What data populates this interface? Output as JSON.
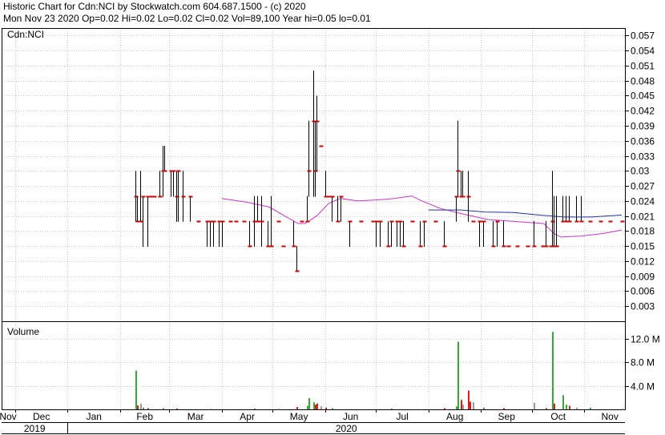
{
  "header": {
    "line1": "Historic Chart for Cdn:NCI by Stockwatch.com 604.687.1500 - (c) 2020",
    "line2": "Mon Nov 23 2020  Op=0.02  Hi=0.02  Lo=0.02  Cl=0.02  Vol=89,100  Year hi=0.05  lo=0.01"
  },
  "chart_data": [
    {
      "type": "ohlc",
      "panel_label": "Cdn:NCI",
      "y_ticks": [
        "0.057",
        "0.054",
        "0.051",
        "0.048",
        "0.045",
        "0.042",
        "0.039",
        "0.036",
        "0.033",
        "0.03",
        "0.027",
        "0.024",
        "0.021",
        "0.018",
        "0.015",
        "0.012",
        "0.009",
        "0.006",
        "0.003"
      ],
      "ylim": [
        0,
        0.0585
      ],
      "x_month_labels": [
        "Nov",
        "Dec",
        "Jan",
        "Feb",
        "Mar",
        "Apr",
        "May",
        "Jun",
        "Jul",
        "Aug",
        "Sep",
        "Oct",
        "Nov"
      ],
      "x_year_labels": [
        "2019",
        "2020"
      ],
      "grid": true,
      "price_color": "#000000",
      "close_tick_color": "#cc0000",
      "bars": [
        {
          "date": "2020-02-10",
          "h": 0.03,
          "l": 0.02,
          "c": 0.025
        },
        {
          "date": "2020-02-11",
          "h": 0.025,
          "l": 0.02,
          "c": 0.02
        },
        {
          "date": "2020-02-13",
          "h": 0.03,
          "l": 0.02,
          "c": 0.02
        },
        {
          "date": "2020-02-14",
          "h": 0.025,
          "l": 0.015,
          "c": 0.025
        },
        {
          "date": "2020-02-17",
          "h": 0.025,
          "l": 0.015,
          "c": 0.025
        },
        {
          "date": "2020-02-19",
          "h": 0.025,
          "l": 0.025,
          "c": 0.025
        },
        {
          "date": "2020-02-21",
          "h": 0.025,
          "l": 0.025,
          "c": 0.025
        },
        {
          "date": "2020-02-24",
          "h": 0.03,
          "l": 0.025,
          "c": 0.025
        },
        {
          "date": "2020-02-26",
          "h": 0.035,
          "l": 0.025,
          "c": 0.03
        },
        {
          "date": "2020-02-27",
          "h": 0.035,
          "l": 0.03,
          "c": 0.03
        },
        {
          "date": "2020-03-02",
          "h": 0.03,
          "l": 0.025,
          "c": 0.03
        },
        {
          "date": "2020-03-03",
          "h": 0.03,
          "l": 0.025,
          "c": 0.03
        },
        {
          "date": "2020-03-05",
          "h": 0.03,
          "l": 0.02,
          "c": 0.025
        },
        {
          "date": "2020-03-06",
          "h": 0.03,
          "l": 0.02,
          "c": 0.03
        },
        {
          "date": "2020-03-09",
          "h": 0.03,
          "l": 0.02,
          "c": 0.025
        },
        {
          "date": "2020-03-13",
          "h": 0.025,
          "l": 0.02,
          "c": 0.025
        },
        {
          "date": "2020-03-18",
          "h": 0.02,
          "l": 0.02,
          "c": 0.02
        },
        {
          "date": "2020-03-23",
          "h": 0.02,
          "l": 0.015,
          "c": 0.02
        },
        {
          "date": "2020-03-25",
          "h": 0.02,
          "l": 0.015,
          "c": 0.02
        },
        {
          "date": "2020-03-27",
          "h": 0.02,
          "l": 0.015,
          "c": 0.02
        },
        {
          "date": "2020-03-30",
          "h": 0.02,
          "l": 0.015,
          "c": 0.02
        },
        {
          "date": "2020-04-01",
          "h": 0.02,
          "l": 0.015,
          "c": 0.02
        },
        {
          "date": "2020-04-06",
          "h": 0.02,
          "l": 0.02,
          "c": 0.02
        },
        {
          "date": "2020-04-09",
          "h": 0.02,
          "l": 0.02,
          "c": 0.02
        },
        {
          "date": "2020-04-14",
          "h": 0.02,
          "l": 0.02,
          "c": 0.02
        },
        {
          "date": "2020-04-17",
          "h": 0.02,
          "l": 0.015,
          "c": 0.015
        },
        {
          "date": "2020-04-20",
          "h": 0.025,
          "l": 0.015,
          "c": 0.02
        },
        {
          "date": "2020-04-22",
          "h": 0.025,
          "l": 0.02,
          "c": 0.02
        },
        {
          "date": "2020-04-24",
          "h": 0.025,
          "l": 0.015,
          "c": 0.02
        },
        {
          "date": "2020-04-28",
          "h": 0.02,
          "l": 0.015,
          "c": 0.015
        },
        {
          "date": "2020-04-30",
          "h": 0.025,
          "l": 0.015,
          "c": 0.015
        },
        {
          "date": "2020-05-04",
          "h": 0.02,
          "l": 0.02,
          "c": 0.02
        },
        {
          "date": "2020-05-07",
          "h": 0.015,
          "l": 0.015,
          "c": 0.015
        },
        {
          "date": "2020-05-13",
          "h": 0.02,
          "l": 0.015,
          "c": 0.015
        },
        {
          "date": "2020-05-15",
          "h": 0.015,
          "l": 0.01,
          "c": 0.01
        },
        {
          "date": "2020-05-18",
          "h": 0.02,
          "l": 0.02,
          "c": 0.02
        },
        {
          "date": "2020-05-21",
          "h": 0.025,
          "l": 0.02,
          "c": 0.02
        },
        {
          "date": "2020-05-22",
          "h": 0.04,
          "l": 0.025,
          "c": 0.03
        },
        {
          "date": "2020-05-25",
          "h": 0.05,
          "l": 0.025,
          "c": 0.04
        },
        {
          "date": "2020-05-26",
          "h": 0.04,
          "l": 0.025,
          "c": 0.03
        },
        {
          "date": "2020-05-27",
          "h": 0.045,
          "l": 0.03,
          "c": 0.04
        },
        {
          "date": "2020-05-29",
          "h": 0.035,
          "l": 0.035,
          "c": 0.035
        },
        {
          "date": "2020-06-01",
          "h": 0.03,
          "l": 0.025,
          "c": 0.025
        },
        {
          "date": "2020-06-03",
          "h": 0.025,
          "l": 0.025,
          "c": 0.025
        },
        {
          "date": "2020-06-05",
          "h": 0.025,
          "l": 0.02,
          "c": 0.025
        },
        {
          "date": "2020-06-08",
          "h": 0.025,
          "l": 0.02,
          "c": 0.02
        },
        {
          "date": "2020-06-10",
          "h": 0.025,
          "l": 0.02,
          "c": 0.025
        },
        {
          "date": "2020-06-15",
          "h": 0.02,
          "l": 0.015,
          "c": 0.02
        },
        {
          "date": "2020-06-22",
          "h": 0.02,
          "l": 0.02,
          "c": 0.02
        },
        {
          "date": "2020-06-29",
          "h": 0.02,
          "l": 0.02,
          "c": 0.02
        },
        {
          "date": "2020-07-01",
          "h": 0.02,
          "l": 0.015,
          "c": 0.02
        },
        {
          "date": "2020-07-03",
          "h": 0.02,
          "l": 0.015,
          "c": 0.02
        },
        {
          "date": "2020-07-08",
          "h": 0.02,
          "l": 0.015,
          "c": 0.015
        },
        {
          "date": "2020-07-10",
          "h": 0.02,
          "l": 0.015,
          "c": 0.02
        },
        {
          "date": "2020-07-13",
          "h": 0.02,
          "l": 0.015,
          "c": 0.02
        },
        {
          "date": "2020-07-15",
          "h": 0.02,
          "l": 0.015,
          "c": 0.02
        },
        {
          "date": "2020-07-17",
          "h": 0.02,
          "l": 0.015,
          "c": 0.015
        },
        {
          "date": "2020-07-22",
          "h": 0.02,
          "l": 0.02,
          "c": 0.02
        },
        {
          "date": "2020-07-27",
          "h": 0.02,
          "l": 0.015,
          "c": 0.015
        },
        {
          "date": "2020-07-29",
          "h": 0.02,
          "l": 0.015,
          "c": 0.02
        },
        {
          "date": "2020-08-05",
          "h": 0.02,
          "l": 0.02,
          "c": 0.02
        },
        {
          "date": "2020-08-10",
          "h": 0.02,
          "l": 0.015,
          "c": 0.015
        },
        {
          "date": "2020-08-17",
          "h": 0.025,
          "l": 0.02,
          "c": 0.025
        },
        {
          "date": "2020-08-18",
          "h": 0.04,
          "l": 0.025,
          "c": 0.03
        },
        {
          "date": "2020-08-20",
          "h": 0.03,
          "l": 0.025,
          "c": 0.025
        },
        {
          "date": "2020-08-21",
          "h": 0.03,
          "l": 0.025,
          "c": 0.025
        },
        {
          "date": "2020-08-24",
          "h": 0.03,
          "l": 0.02,
          "c": 0.025
        },
        {
          "date": "2020-08-27",
          "h": 0.02,
          "l": 0.02,
          "c": 0.02
        },
        {
          "date": "2020-08-31",
          "h": 0.02,
          "l": 0.015,
          "c": 0.02
        },
        {
          "date": "2020-09-02",
          "h": 0.02,
          "l": 0.015,
          "c": 0.02
        },
        {
          "date": "2020-09-08",
          "h": 0.02,
          "l": 0.015,
          "c": 0.015
        },
        {
          "date": "2020-09-10",
          "h": 0.02,
          "l": 0.015,
          "c": 0.02
        },
        {
          "date": "2020-09-14",
          "h": 0.02,
          "l": 0.015,
          "c": 0.015
        },
        {
          "date": "2020-09-17",
          "h": 0.015,
          "l": 0.015,
          "c": 0.015
        },
        {
          "date": "2020-09-22",
          "h": 0.015,
          "l": 0.015,
          "c": 0.015
        },
        {
          "date": "2020-09-28",
          "h": 0.015,
          "l": 0.015,
          "c": 0.015
        },
        {
          "date": "2020-10-02",
          "h": 0.02,
          "l": 0.015,
          "c": 0.015
        },
        {
          "date": "2020-10-07",
          "h": 0.015,
          "l": 0.015,
          "c": 0.015
        },
        {
          "date": "2020-10-09",
          "h": 0.02,
          "l": 0.015,
          "c": 0.015
        },
        {
          "date": "2020-10-12",
          "h": 0.015,
          "l": 0.015,
          "c": 0.015
        },
        {
          "date": "2020-10-13",
          "h": 0.03,
          "l": 0.015,
          "c": 0.02
        },
        {
          "date": "2020-10-14",
          "h": 0.025,
          "l": 0.015,
          "c": 0.015
        },
        {
          "date": "2020-10-15",
          "h": 0.025,
          "l": 0.015,
          "c": 0.015
        },
        {
          "date": "2020-10-19",
          "h": 0.025,
          "l": 0.02,
          "c": 0.02
        },
        {
          "date": "2020-10-21",
          "h": 0.025,
          "l": 0.02,
          "c": 0.02
        },
        {
          "date": "2020-10-23",
          "h": 0.025,
          "l": 0.02,
          "c": 0.02
        },
        {
          "date": "2020-10-27",
          "h": 0.025,
          "l": 0.02,
          "c": 0.02
        },
        {
          "date": "2020-10-30",
          "h": 0.025,
          "l": 0.02,
          "c": 0.02
        },
        {
          "date": "2020-11-04",
          "h": 0.02,
          "l": 0.02,
          "c": 0.02
        },
        {
          "date": "2020-11-10",
          "h": 0.02,
          "l": 0.02,
          "c": 0.02
        },
        {
          "date": "2020-11-16",
          "h": 0.02,
          "l": 0.02,
          "c": 0.02
        },
        {
          "date": "2020-11-23",
          "h": 0.02,
          "l": 0.02,
          "c": 0.02
        }
      ],
      "moving_averages": [
        {
          "color": "#cc33cc",
          "points": [
            [
              "2020-04-01",
              0.0245
            ],
            [
              "2020-04-15",
              0.0238
            ],
            [
              "2020-04-29",
              0.0228
            ],
            [
              "2020-05-08",
              0.021
            ],
            [
              "2020-05-16",
              0.0195
            ],
            [
              "2020-05-20",
              0.0195
            ],
            [
              "2020-05-27",
              0.021
            ],
            [
              "2020-06-03",
              0.0235
            ],
            [
              "2020-06-10",
              0.0245
            ],
            [
              "2020-06-20",
              0.024
            ],
            [
              "2020-07-01",
              0.0242
            ],
            [
              "2020-07-12",
              0.0245
            ],
            [
              "2020-07-22",
              0.025
            ],
            [
              "2020-07-28",
              0.024
            ],
            [
              "2020-08-08",
              0.0225
            ],
            [
              "2020-08-20",
              0.0215
            ],
            [
              "2020-09-05",
              0.0203
            ],
            [
              "2020-09-25",
              0.0198
            ],
            [
              "2020-10-08",
              0.0195
            ],
            [
              "2020-10-14",
              0.0175
            ],
            [
              "2020-10-18",
              0.0168
            ],
            [
              "2020-10-30",
              0.017
            ],
            [
              "2020-11-12",
              0.0175
            ],
            [
              "2020-11-23",
              0.0182
            ]
          ]
        },
        {
          "color": "#2233aa",
          "points": [
            [
              "2020-08-01",
              0.0222
            ],
            [
              "2020-08-20",
              0.0222
            ],
            [
              "2020-09-03",
              0.0218
            ],
            [
              "2020-09-20",
              0.0217
            ],
            [
              "2020-10-05",
              0.0212
            ],
            [
              "2020-10-20",
              0.0208
            ],
            [
              "2020-11-05",
              0.0208
            ],
            [
              "2020-11-23",
              0.0212
            ]
          ]
        }
      ]
    },
    {
      "type": "bar",
      "panel_label": "Volume",
      "y_ticks": [
        "12.0 M",
        "8.0 M",
        "4.0 M"
      ],
      "ylim": [
        0,
        15000000
      ],
      "up_color": "#33aa33",
      "down_color": "#cc2222",
      "neutral_color": "#999999",
      "bars": [
        {
          "date": "2020-02-10",
          "v": 6600000,
          "dir": "up"
        },
        {
          "date": "2020-02-11",
          "v": 700000,
          "dir": "down"
        },
        {
          "date": "2020-02-13",
          "v": 1000000,
          "dir": "neutral"
        },
        {
          "date": "2020-02-14",
          "v": 300000,
          "dir": "up"
        },
        {
          "date": "2020-02-17",
          "v": 200000,
          "dir": "down"
        },
        {
          "date": "2020-02-26",
          "v": 200000,
          "dir": "up"
        },
        {
          "date": "2020-03-05",
          "v": 150000,
          "dir": "down"
        },
        {
          "date": "2020-03-25",
          "v": 100000,
          "dir": "neutral"
        },
        {
          "date": "2020-04-20",
          "v": 150000,
          "dir": "up"
        },
        {
          "date": "2020-05-04",
          "v": 100000,
          "dir": "neutral"
        },
        {
          "date": "2020-05-15",
          "v": 400000,
          "dir": "down"
        },
        {
          "date": "2020-05-21",
          "v": 600000,
          "dir": "up"
        },
        {
          "date": "2020-05-22",
          "v": 1900000,
          "dir": "up"
        },
        {
          "date": "2020-05-25",
          "v": 1200000,
          "dir": "up"
        },
        {
          "date": "2020-05-26",
          "v": 800000,
          "dir": "down"
        },
        {
          "date": "2020-05-27",
          "v": 1000000,
          "dir": "down"
        },
        {
          "date": "2020-05-29",
          "v": 500000,
          "dir": "neutral"
        },
        {
          "date": "2020-06-01",
          "v": 300000,
          "dir": "down"
        },
        {
          "date": "2020-06-05",
          "v": 200000,
          "dir": "up"
        },
        {
          "date": "2020-07-10",
          "v": 150000,
          "dir": "up"
        },
        {
          "date": "2020-08-10",
          "v": 200000,
          "dir": "down"
        },
        {
          "date": "2020-08-17",
          "v": 500000,
          "dir": "up"
        },
        {
          "date": "2020-08-18",
          "v": 11500000,
          "dir": "up"
        },
        {
          "date": "2020-08-20",
          "v": 1600000,
          "dir": "down"
        },
        {
          "date": "2020-08-21",
          "v": 800000,
          "dir": "neutral"
        },
        {
          "date": "2020-08-24",
          "v": 3200000,
          "dir": "down"
        },
        {
          "date": "2020-08-25",
          "v": 1300000,
          "dir": "down"
        },
        {
          "date": "2020-08-27",
          "v": 1200000,
          "dir": "neutral"
        },
        {
          "date": "2020-09-02",
          "v": 300000,
          "dir": "up"
        },
        {
          "date": "2020-09-14",
          "v": 200000,
          "dir": "down"
        },
        {
          "date": "2020-10-02",
          "v": 1100000,
          "dir": "neutral"
        },
        {
          "date": "2020-10-09",
          "v": 200000,
          "dir": "down"
        },
        {
          "date": "2020-10-13",
          "v": 13200000,
          "dir": "up"
        },
        {
          "date": "2020-10-14",
          "v": 1000000,
          "dir": "down"
        },
        {
          "date": "2020-10-19",
          "v": 2400000,
          "dir": "up"
        },
        {
          "date": "2020-10-21",
          "v": 800000,
          "dir": "up"
        },
        {
          "date": "2020-10-23",
          "v": 600000,
          "dir": "down"
        },
        {
          "date": "2020-10-27",
          "v": 300000,
          "dir": "neutral"
        },
        {
          "date": "2020-11-04",
          "v": 300000,
          "dir": "up"
        },
        {
          "date": "2020-11-23",
          "v": 89100,
          "dir": "neutral"
        }
      ]
    }
  ]
}
